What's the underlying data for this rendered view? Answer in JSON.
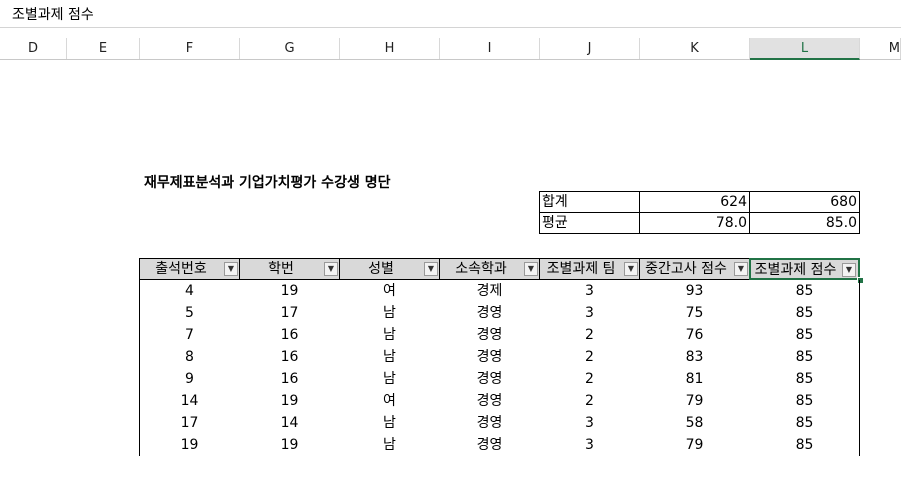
{
  "formula_bar": {
    "text": "조별과제 점수"
  },
  "columns": [
    "D",
    "E",
    "F",
    "G",
    "H",
    "I",
    "J",
    "K",
    "L",
    "M"
  ],
  "selected_column": "L",
  "sheet_title": "재무제표분석과 기업가치평가 수강생 명단",
  "summary": {
    "rows": [
      {
        "label": "합계",
        "values": [
          "624",
          "680"
        ]
      },
      {
        "label": "평균",
        "values": [
          "78.0",
          "85.0"
        ]
      }
    ]
  },
  "table": {
    "headers": [
      "출석번호",
      "학번",
      "성별",
      "소속학과",
      "조별과제 팀",
      "중간고사 점수",
      "조별과제 점수"
    ],
    "rows": [
      [
        "4",
        "19",
        "여",
        "경제",
        "3",
        "93",
        "85"
      ],
      [
        "5",
        "17",
        "남",
        "경영",
        "3",
        "75",
        "85"
      ],
      [
        "7",
        "16",
        "남",
        "경영",
        "2",
        "76",
        "85"
      ],
      [
        "8",
        "16",
        "남",
        "경영",
        "2",
        "83",
        "85"
      ],
      [
        "9",
        "16",
        "남",
        "경영",
        "2",
        "81",
        "85"
      ],
      [
        "14",
        "19",
        "여",
        "경영",
        "2",
        "79",
        "85"
      ],
      [
        "17",
        "14",
        "남",
        "경영",
        "3",
        "58",
        "85"
      ],
      [
        "19",
        "19",
        "남",
        "경영",
        "3",
        "79",
        "85"
      ]
    ]
  },
  "icons": {
    "filter": "filter-dropdown-icon",
    "filter_active": "filter-active-icon"
  },
  "colors": {
    "accent": "#217346",
    "header_fill": "#d9d9d9"
  }
}
